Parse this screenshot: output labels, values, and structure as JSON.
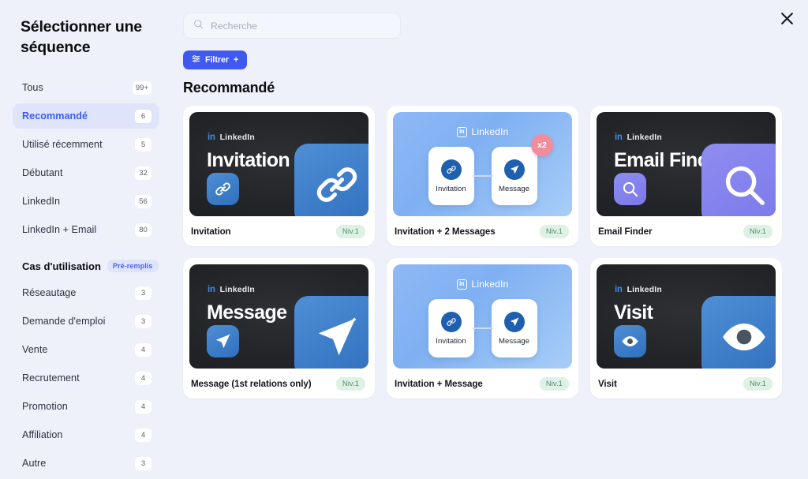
{
  "modal": {
    "title": "Sélectionner une séquence",
    "close_icon": "close-icon"
  },
  "sidebar": {
    "nav": [
      {
        "label": "Tous",
        "count": "99+",
        "active": false
      },
      {
        "label": "Recommandé",
        "count": "6",
        "active": true
      },
      {
        "label": "Utilisé récemment",
        "count": "5",
        "active": false
      },
      {
        "label": "Débutant",
        "count": "32",
        "active": false
      },
      {
        "label": "LinkedIn",
        "count": "56",
        "active": false
      },
      {
        "label": "LinkedIn + Email",
        "count": "80",
        "active": false
      }
    ],
    "usecase_section": {
      "title": "Cas d'utilisation",
      "badge": "Pré-remplis"
    },
    "usecases": [
      {
        "label": "Réseautage",
        "count": "3"
      },
      {
        "label": "Demande d'emploi",
        "count": "3"
      },
      {
        "label": "Vente",
        "count": "4"
      },
      {
        "label": "Recrutement",
        "count": "4"
      },
      {
        "label": "Promotion",
        "count": "4"
      },
      {
        "label": "Affiliation",
        "count": "4"
      },
      {
        "label": "Autre",
        "count": "3"
      }
    ]
  },
  "search": {
    "placeholder": "Recherche",
    "value": "",
    "icon": "search-icon"
  },
  "filter_button": {
    "label": "Filtrer",
    "icon": "sliders-icon",
    "plus": "+"
  },
  "section_title": "Recommandé",
  "cards": [
    {
      "style": "dark",
      "accent": "blue",
      "linkedin_label": "LinkedIn",
      "linkedin_mark": "in",
      "thumb_title": "Invitation",
      "icon": "link-icon",
      "name": "Invitation",
      "level": "Niv.1"
    },
    {
      "style": "flow",
      "accent": "blue",
      "linkedin_label": "LinkedIn",
      "linkedin_mark": "in",
      "nodes": [
        {
          "label": "Invitation",
          "icon": "link-icon"
        },
        {
          "label": "Message",
          "icon": "send-icon"
        }
      ],
      "repeat_badge": "x2",
      "name": "Invitation + 2 Messages",
      "level": "Niv.1"
    },
    {
      "style": "dark",
      "accent": "purple",
      "linkedin_label": "LinkedIn",
      "linkedin_mark": "in",
      "thumb_title": "Email Finder",
      "icon": "magnifier-icon",
      "name": "Email Finder",
      "level": "Niv.1"
    },
    {
      "style": "dark",
      "accent": "blue",
      "linkedin_label": "LinkedIn",
      "linkedin_mark": "in",
      "thumb_title": "Message",
      "icon": "send-icon",
      "name": "Message (1st relations only)",
      "level": "Niv.1"
    },
    {
      "style": "flow",
      "accent": "blue",
      "linkedin_label": "LinkedIn",
      "linkedin_mark": "in",
      "nodes": [
        {
          "label": "Invitation",
          "icon": "link-icon"
        },
        {
          "label": "Message",
          "icon": "send-icon"
        }
      ],
      "repeat_badge": null,
      "name": "Invitation + Message",
      "level": "Niv.1"
    },
    {
      "style": "dark",
      "accent": "blue",
      "linkedin_label": "LinkedIn",
      "linkedin_mark": "in",
      "thumb_title": "Visit",
      "icon": "eye-icon",
      "name": "Visit",
      "level": "Niv.1"
    }
  ],
  "colors": {
    "background": "#eef1fa",
    "accent_blue": "#4059f0",
    "active_bg": "#dfe4fb",
    "level_badge_bg": "#ddf1e4",
    "level_badge_text": "#5d8a72",
    "repeat_badge_bg": "#ef8d9c"
  }
}
